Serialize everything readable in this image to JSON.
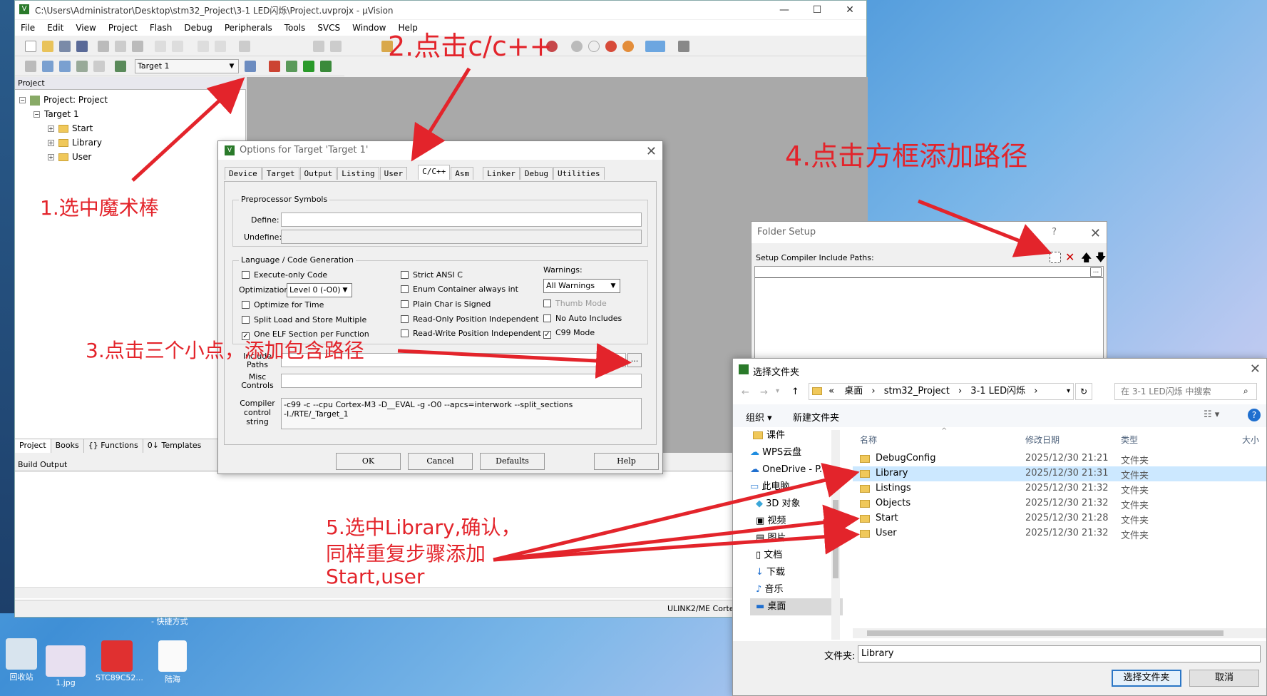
{
  "window": {
    "title": "C:\\Users\\Administrator\\Desktop\\stm32_Project\\3-1 LED闪烁\\Project.uvprojx - µVision"
  },
  "menu": [
    "File",
    "Edit",
    "View",
    "Project",
    "Flash",
    "Debug",
    "Peripherals",
    "Tools",
    "SVCS",
    "Window",
    "Help"
  ],
  "toolbar": {
    "target_select": "Target 1"
  },
  "project_panel": {
    "header": "Project",
    "root": "Project: Project",
    "target": "Target 1",
    "groups": [
      "Start",
      "Library",
      "User"
    ]
  },
  "panel_tabs": [
    "Project",
    "Books",
    "{} Functions",
    "0↓ Templates"
  ],
  "build_output": {
    "header": "Build Output"
  },
  "status": {
    "debugger": "ULINK2/ME Corte"
  },
  "options_dialog": {
    "title": "Options for Target 'Target 1'",
    "tabs": [
      "Device",
      "Target",
      "Output",
      "Listing",
      "User",
      "C/C++",
      "Asm",
      "Linker",
      "Debug",
      "Utilities"
    ],
    "active_tab": "C/C++",
    "preproc": {
      "group": "Preprocessor Symbols",
      "define_label": "Define:",
      "define_value": "",
      "undefine_label": "Undefine:"
    },
    "lang": {
      "group": "Language / Code Generation",
      "execute_only": "Execute-only Code",
      "optimization_label": "Optimization:",
      "optimization_value": "Level 0 (-O0)",
      "optimize_time": "Optimize for Time",
      "split_load": "Split Load and Store Multiple",
      "one_elf": "One ELF Section per Function",
      "strict_ansi": "Strict ANSI C",
      "enum_container": "Enum Container always int",
      "plain_char": "Plain Char is Signed",
      "ro_pos": "Read-Only Position Independent",
      "rw_pos": "Read-Write Position Independent",
      "warnings_label": "Warnings:",
      "warnings_value": "All Warnings",
      "thumb": "Thumb Mode",
      "no_auto": "No Auto Includes",
      "c99": "C99 Mode"
    },
    "include_label": "Include Paths",
    "misc_label": "Misc Controls",
    "compiler_label": "Compiler control string",
    "compiler_string_1": "-c99 -c --cpu Cortex-M3 -D__EVAL -g -O0 --apcs=interwork --split_sections",
    "compiler_string_2": "-I./RTE/_Target_1",
    "buttons": {
      "ok": "OK",
      "cancel": "Cancel",
      "defaults": "Defaults",
      "help": "Help"
    }
  },
  "folder_setup": {
    "title": "Folder Setup",
    "question": "?",
    "label": "Setup Compiler Include Paths:",
    "ellipsis": "..."
  },
  "choose_folder": {
    "title": "选择文件夹",
    "breadcrumb": [
      "«",
      "桌面",
      "stm32_Project",
      "3-1 LED闪烁"
    ],
    "search_placeholder": "在 3-1 LED闪烁 中搜索",
    "organize": "组织 ▾",
    "new_folder": "新建文件夹",
    "columns": {
      "name": "名称",
      "date": "修改日期",
      "type": "类型",
      "size": "大小"
    },
    "sidebar": [
      "课件",
      "WPS云盘",
      "OneDrive - P...",
      "此电脑",
      "3D 对象",
      "视频",
      "图片",
      "文档",
      "下载",
      "音乐",
      "桌面"
    ],
    "files": [
      {
        "name": "DebugConfig",
        "date": "2025/12/30 21:21",
        "type": "文件夹"
      },
      {
        "name": "Library",
        "date": "2025/12/30 21:31",
        "type": "文件夹"
      },
      {
        "name": "Listings",
        "date": "2025/12/30 21:32",
        "type": "文件夹"
      },
      {
        "name": "Objects",
        "date": "2025/12/30 21:32",
        "type": "文件夹"
      },
      {
        "name": "Start",
        "date": "2025/12/30 21:28",
        "type": "文件夹"
      },
      {
        "name": "User",
        "date": "2025/12/30 21:32",
        "type": "文件夹"
      }
    ],
    "selected": "Library",
    "folder_label": "文件夹:",
    "folder_value": "Library",
    "select_button": "选择文件夹",
    "cancel_button": "取消"
  },
  "desktop": {
    "shortcut_label": "- 快捷方式",
    "items": [
      "回收站",
      "1.jpg",
      "STC89C52...",
      "陆海"
    ]
  },
  "annotations": {
    "step1": "1.选中魔术棒",
    "step2": "2.点击c/c++",
    "step3": "3.点击三个小点，添加包含路径",
    "step4": "4.点击方框添加路径",
    "step5_line1": "5.选中Library,确认，",
    "step5_line2": "同样重复步骤添加",
    "step5_line3": "Start,user"
  },
  "colors": {
    "annotation": "#e3242b",
    "selection": "#cce8ff",
    "accent": "#2a76c6"
  }
}
